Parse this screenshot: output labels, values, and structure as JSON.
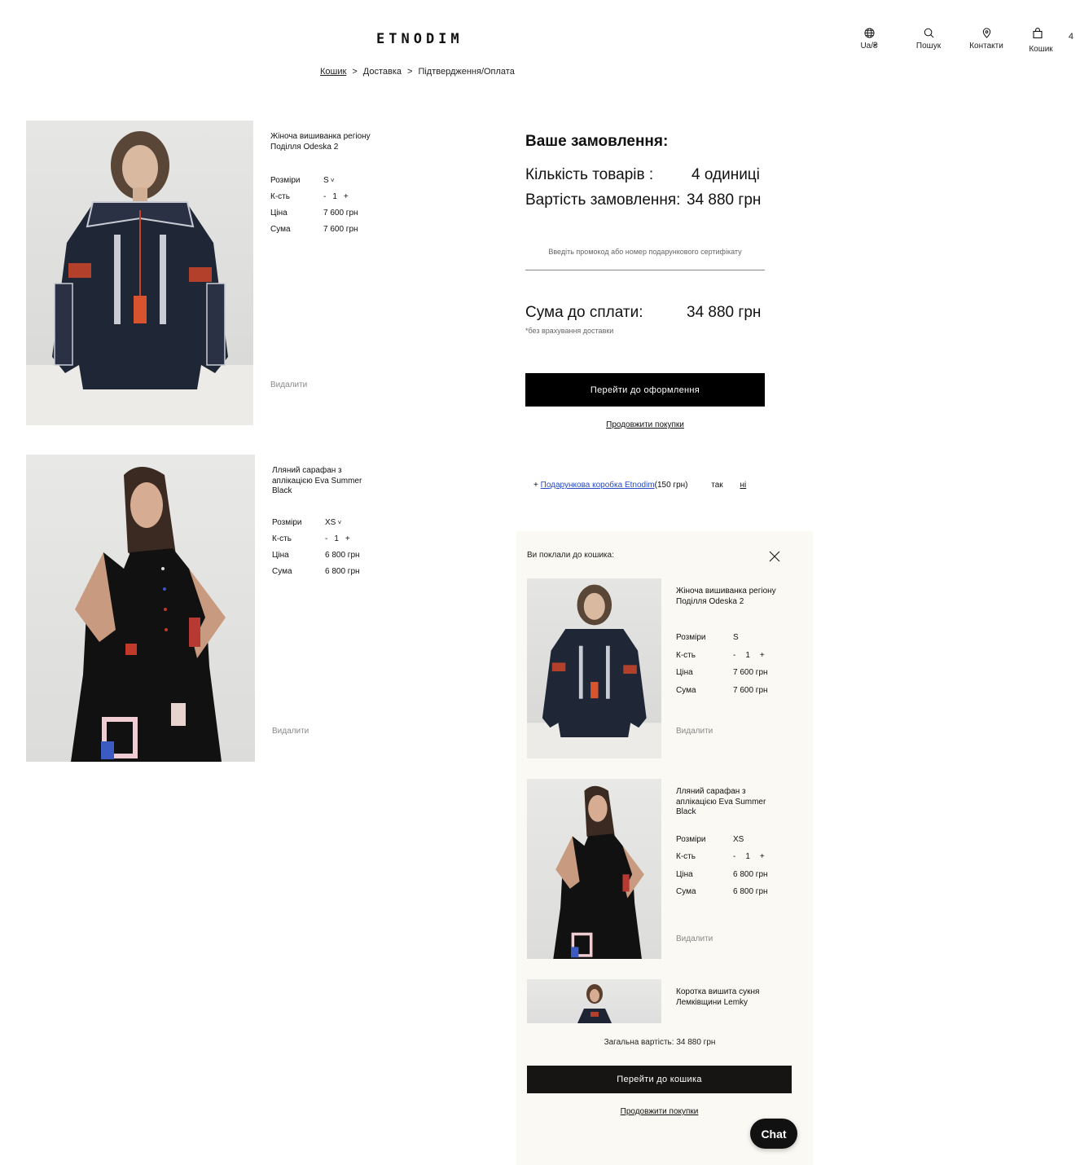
{
  "header": {
    "logo": "ETNODIM",
    "nav": [
      {
        "label": "Ua/₴",
        "icon": "globe-icon"
      },
      {
        "label": "Пошук",
        "icon": "search-icon"
      },
      {
        "label": "Контакти",
        "icon": "location-pin-icon"
      },
      {
        "label": "Кошик",
        "icon": "bag-icon",
        "count": "4"
      }
    ]
  },
  "breadcrumb": {
    "items": [
      "Кошик",
      "Доставка",
      "Підтвердження/Оплата"
    ],
    "separator": ">"
  },
  "cart": {
    "items": [
      {
        "title": "Жіноча вишиванка регіону Поділля Odeska 2",
        "size_label": "Розміри",
        "size": "S",
        "qty_label": "К-сть",
        "qty_minus": "-",
        "qty": "1",
        "qty_plus": "+",
        "price_label": "Ціна",
        "price": "7 600 грн",
        "sum_label": "Сума",
        "sum": "7 600 грн",
        "remove": "Видалити"
      },
      {
        "title": "Лляний сарафан з аплікацією Eva Summer Black",
        "size_label": "Розміри",
        "size": "XS",
        "qty_label": "К-сть",
        "qty_minus": "-",
        "qty": "1",
        "qty_plus": "+",
        "price_label": "Ціна",
        "price": "6 800 грн",
        "sum_label": "Сума",
        "sum": "6 800 грн",
        "remove": "Видалити"
      }
    ]
  },
  "order": {
    "title": "Ваше замовлення:",
    "count_label": "Кількість товарів :",
    "count_value": "4 одиниці",
    "cost_label": "Вартість замовлення:",
    "cost_value": "34 880 грн",
    "promo_placeholder": "Введіть промокод або номер подарункового сертифікату",
    "total_label": "Сума до сплати:",
    "total_value": "34 880 грн",
    "note": "*без врахування доставки",
    "checkout_button": "Перейти до оформлення",
    "continue_link": "Продовжити покупки",
    "gift": {
      "prefix": "+",
      "link": "Подарункова коробка Etnodim",
      "price": "(150 грн)",
      "yes": "так",
      "no": "ні"
    }
  },
  "mini_cart": {
    "heading": "Ви поклали до кошика:",
    "items": [
      {
        "title": "Жіноча вишиванка регіону Поділля Odeska 2",
        "size_label": "Розміри",
        "size": "S",
        "qty_label": "К-сть",
        "qty_minus": "-",
        "qty": "1",
        "qty_plus": "+",
        "price_label": "Ціна",
        "price": "7 600 грн",
        "sum_label": "Сума",
        "sum": "7 600 грн",
        "remove": "Видалити"
      },
      {
        "title": "Лляний сарафан з аплікацією Eva Summer Black",
        "size_label": "Розміри",
        "size": "XS",
        "qty_label": "К-сть",
        "qty_minus": "-",
        "qty": "1",
        "qty_plus": "+",
        "price_label": "Ціна",
        "price": "6 800 грн",
        "sum_label": "Сума",
        "sum": "6 800 грн",
        "remove": "Видалити"
      },
      {
        "title": "Коротка вишита сукня Лемківщини Lemky"
      }
    ],
    "total": "Загальна вартість: 34 880 грн",
    "cart_button": "Перейти до кошика",
    "continue_link": "Продовжити покупки"
  },
  "chat": {
    "label": "Chat"
  },
  "colors": {
    "accent": "#000000",
    "panel_bg": "#fbf9f3",
    "link": "#2a4bbf"
  }
}
